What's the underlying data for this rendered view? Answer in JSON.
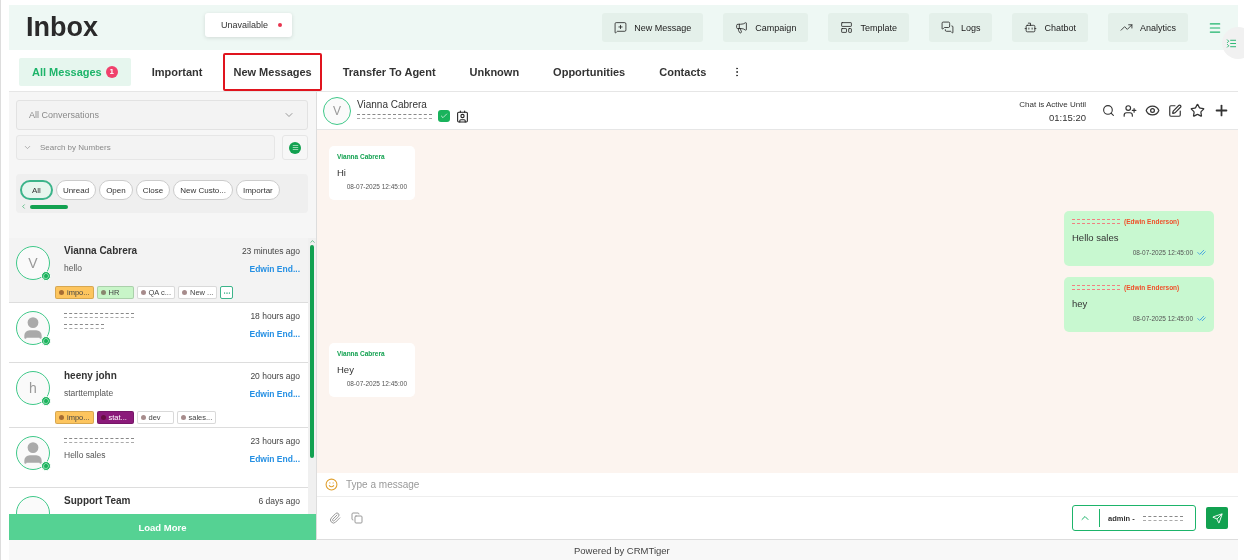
{
  "header": {
    "title": "Inbox",
    "status": {
      "label": "Unavailable",
      "online": false
    },
    "actions": [
      {
        "label": "New Message",
        "kind": "new-message"
      },
      {
        "label": "Campaign",
        "kind": "campaign"
      },
      {
        "label": "Template",
        "kind": "template"
      },
      {
        "label": "Logs",
        "kind": "logs"
      },
      {
        "label": "Chatbot",
        "kind": "chatbot"
      },
      {
        "label": "Analytics",
        "kind": "analytics"
      }
    ]
  },
  "tabs": [
    {
      "label": "All Messages",
      "selected": true,
      "highlighted": false,
      "badge": "1"
    },
    {
      "label": "Important",
      "selected": false,
      "highlighted": false
    },
    {
      "label": "New Messages",
      "selected": false,
      "highlighted": true
    },
    {
      "label": "Transfer To Agent",
      "selected": false,
      "highlighted": false
    },
    {
      "label": "Unknown",
      "selected": false,
      "highlighted": false
    },
    {
      "label": "Opportunities",
      "selected": false,
      "highlighted": false
    },
    {
      "label": "Contacts",
      "selected": false,
      "highlighted": false
    }
  ],
  "sidebar": {
    "conversation_filter": {
      "placeholder": "All Conversations"
    },
    "search": {
      "placeholder": "Search by Numbers"
    },
    "chips": [
      {
        "label": "All",
        "selected": true
      },
      {
        "label": "Unread",
        "selected": false
      },
      {
        "label": "Open",
        "selected": false
      },
      {
        "label": "Close",
        "selected": false
      },
      {
        "label": "New Custo...",
        "selected": false
      },
      {
        "label": "Importar",
        "selected": false
      }
    ],
    "conversations": [
      {
        "name": "Vianna Cabrera",
        "avatar": "V",
        "time": "23 minutes ago",
        "preview": "hello",
        "agent": "Edwin End...",
        "channel": true,
        "selected": true,
        "more_tags": true,
        "tags": [
          {
            "label": "impo...",
            "color": "#fdc55e"
          },
          {
            "label": "HR",
            "color": "#c8f5c8"
          },
          {
            "label": "QA c...",
            "color": "#ffffff"
          },
          {
            "label": "New ...",
            "color": "#ffffff"
          }
        ]
      },
      {
        "hidden_name": true,
        "time": "18 hours ago",
        "hidden_preview": true,
        "agent": "Edwin End...",
        "channel": true,
        "selected": false
      },
      {
        "name": "heeny john",
        "avatar": "h",
        "time": "20 hours ago",
        "preview": "starttemplate",
        "agent": "Edwin End...",
        "channel": true,
        "selected": false,
        "tags": [
          {
            "label": "impo...",
            "color": "#fdc55e"
          },
          {
            "label": "stat...",
            "color": "#8b1a7a"
          },
          {
            "label": "dev",
            "color": "#ffffff"
          },
          {
            "label": "sales...",
            "color": "#ffffff"
          }
        ]
      },
      {
        "hidden_name": true,
        "time": "23 hours ago",
        "preview": "Hello sales",
        "agent": "Edwin End...",
        "channel": true,
        "selected": false
      },
      {
        "name": "Support Team",
        "time": "6 days ago",
        "selected": false
      }
    ],
    "load_more": "Load More"
  },
  "chat": {
    "contact": {
      "name": "Vianna Cabrera",
      "avatar": "V",
      "verified": true
    },
    "active_label": "Chat is Active Until",
    "timer": "01:15:20",
    "messages": [
      {
        "kind": "incoming",
        "sender": "Vianna Cabrera",
        "text": "Hi",
        "time": "08-07-2025 12:45:00"
      },
      {
        "kind": "outgoing",
        "sender": "(Edwin Enderson)",
        "text": "Hello sales",
        "time": "08-07-2025 12:45:00",
        "read": true
      },
      {
        "kind": "outgoing",
        "sender": "(Edwin Enderson)",
        "text": "hey",
        "time": "08-07-2025 12:45:00",
        "read": true
      },
      {
        "kind": "incoming",
        "sender": "Vianna Cabrera",
        "text": "Hey",
        "time": "08-07-2025 12:45:00"
      }
    ],
    "composer": {
      "placeholder": "Type a message",
      "sender_label": "admin - "
    }
  },
  "footer": "Powered by CRMTiger"
}
